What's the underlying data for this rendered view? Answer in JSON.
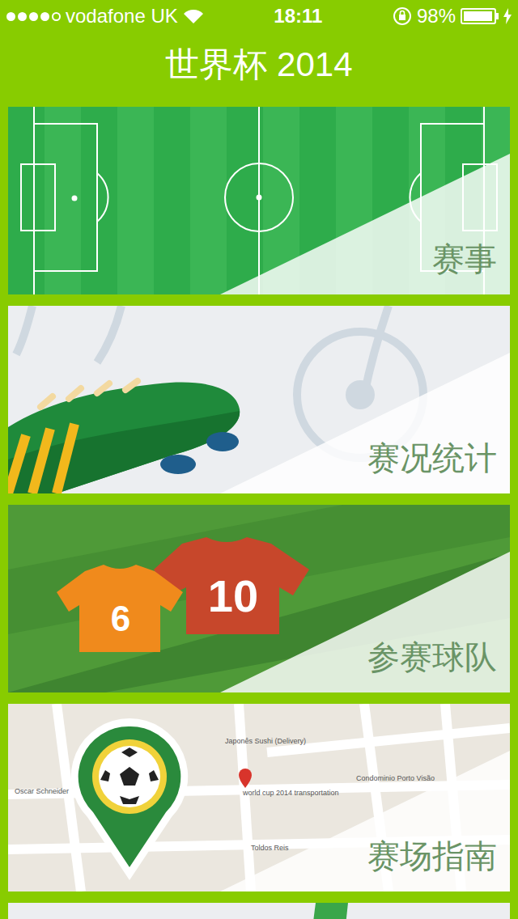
{
  "status_bar": {
    "carrier": "vodafone UK",
    "time": "18:11",
    "battery": "98%",
    "signal_level": 0.8,
    "battery_level": 0.98,
    "charging": true
  },
  "title": "世界杯 2014",
  "cards": [
    {
      "kind": "pitch",
      "label": "赛事"
    },
    {
      "kind": "boot",
      "label": "赛况统计"
    },
    {
      "kind": "shirts",
      "label": "参赛球队",
      "numbers": [
        "6",
        "10"
      ]
    },
    {
      "kind": "map",
      "label": "赛场指南",
      "map_labels": [
        "world cup 2014 transportation",
        "Japonês Sushi (Delivery)",
        "Condominio Porto Visão",
        "Oscar Schneider",
        "Toldos Reis"
      ]
    },
    {
      "kind": "partial"
    }
  ]
}
